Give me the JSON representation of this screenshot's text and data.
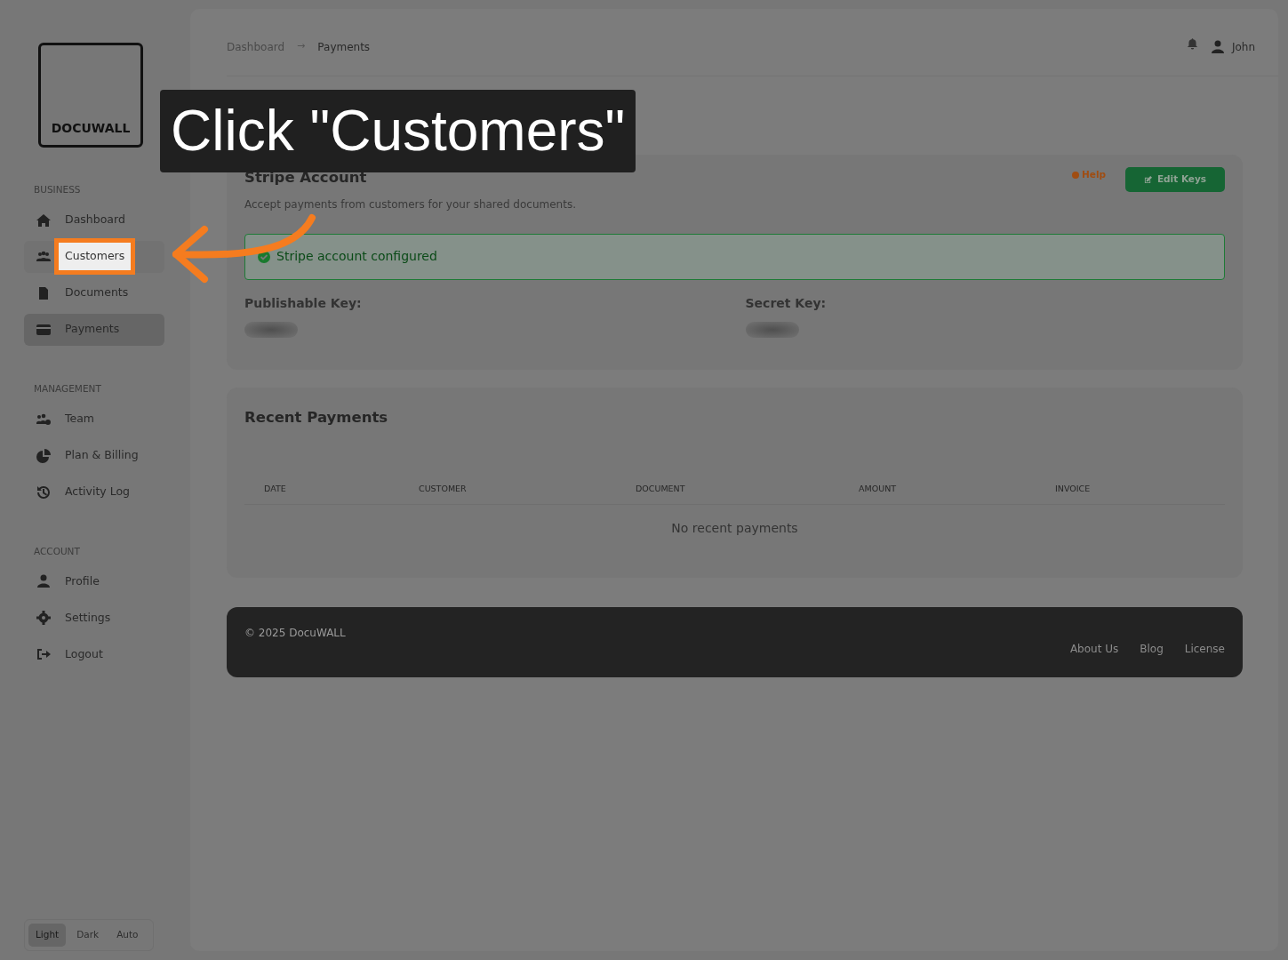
{
  "logo": {
    "text": "DOCUWALL"
  },
  "tutorial": {
    "caption": "Click \"Customers\""
  },
  "sidebar": {
    "sections": [
      {
        "title": "BUSINESS",
        "items": [
          {
            "label": "Dashboard",
            "selected": false,
            "highlighted": false
          },
          {
            "label": "Customers",
            "selected": false,
            "highlighted": true
          },
          {
            "label": "Documents",
            "selected": false,
            "highlighted": false
          },
          {
            "label": "Payments",
            "selected": true,
            "highlighted": false
          }
        ]
      },
      {
        "title": "MANAGEMENT",
        "items": [
          {
            "label": "Team",
            "selected": false,
            "highlighted": false
          },
          {
            "label": "Plan & Billing",
            "selected": false,
            "highlighted": false
          },
          {
            "label": "Activity Log",
            "selected": false,
            "highlighted": false
          }
        ]
      },
      {
        "title": "ACCOUNT",
        "items": [
          {
            "label": "Profile",
            "selected": false,
            "highlighted": false
          },
          {
            "label": "Settings",
            "selected": false,
            "highlighted": false
          },
          {
            "label": "Logout",
            "selected": false,
            "highlighted": false
          }
        ]
      }
    ],
    "theme": [
      {
        "label": "Light",
        "selected": true
      },
      {
        "label": "Dark",
        "selected": false
      },
      {
        "label": "Auto",
        "selected": false
      }
    ]
  },
  "header": {
    "breadcrumb": [
      "Dashboard",
      "Payments"
    ],
    "separator": "→",
    "user": "John"
  },
  "stripe": {
    "title": "Stripe Account",
    "subtitle": "Accept payments from customers for your shared documents.",
    "help": "Help",
    "edit": "Edit Keys",
    "status": "Stripe account configured",
    "keys": [
      "Publishable Key:",
      "Secret Key:"
    ]
  },
  "payments": {
    "title": "Recent Payments",
    "columns": [
      "DATE",
      "CUSTOMER",
      "DOCUMENT",
      "AMOUNT",
      "INVOICE"
    ],
    "empty": "No recent payments"
  },
  "footer": {
    "copyright": "© 2025 DocuWALL",
    "links": [
      "About Us",
      "Blog",
      "License"
    ]
  }
}
